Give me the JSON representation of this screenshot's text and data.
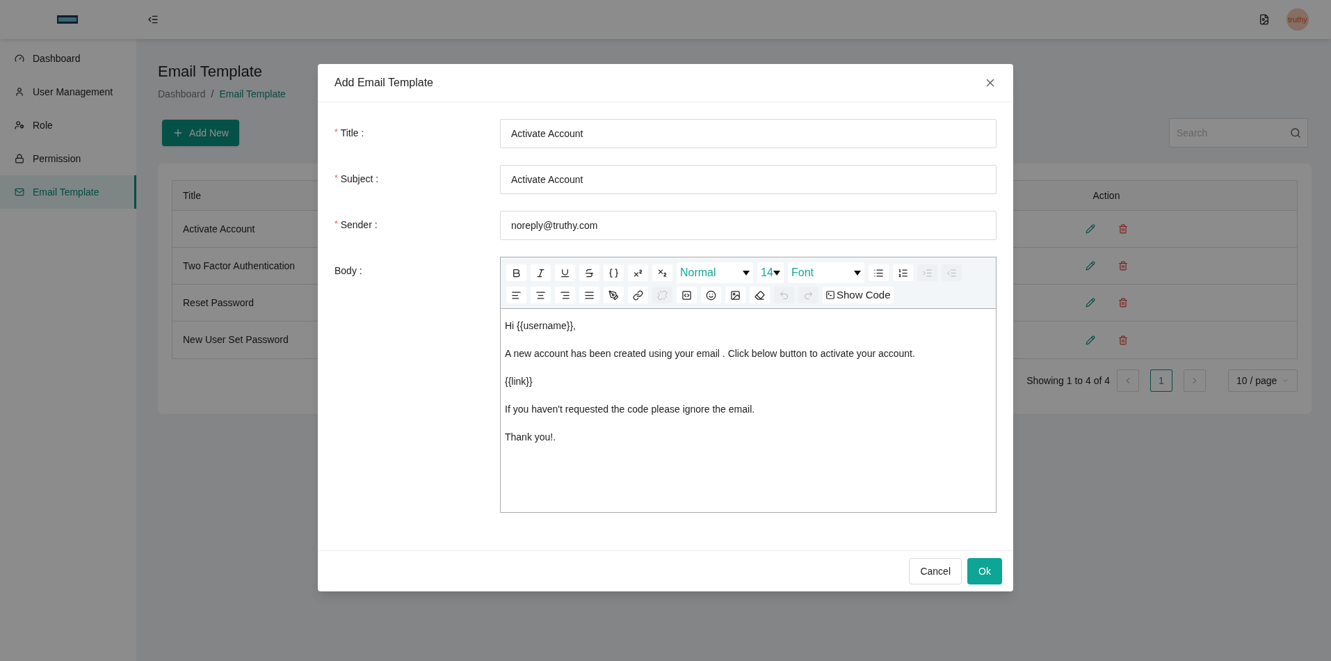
{
  "header": {
    "avatar_text": "truthy"
  },
  "sidebar": {
    "items": [
      {
        "label": "Dashboard",
        "selected": false
      },
      {
        "label": "User Management",
        "selected": false
      },
      {
        "label": "Role",
        "selected": false
      },
      {
        "label": "Permission",
        "selected": false
      },
      {
        "label": "Email Template",
        "selected": true
      }
    ]
  },
  "page": {
    "title": "Email Template",
    "breadcrumb": [
      {
        "label": "Dashboard",
        "current": false
      },
      {
        "label": "Email Template",
        "current": true
      }
    ],
    "separator": "/",
    "add_button": "Add New",
    "search": {
      "placeholder": "Search"
    }
  },
  "table": {
    "columns": [
      "Title",
      "Action"
    ],
    "rows": [
      {
        "title": "Activate Account"
      },
      {
        "title": "Two Factor Authentication"
      },
      {
        "title": "Reset Password"
      },
      {
        "title": "New User Set Password"
      }
    ]
  },
  "pagination": {
    "summary": "Showing 1 to 4 of 4",
    "pages": [
      {
        "label": "1",
        "selected": true
      }
    ],
    "page_size": "10 / page"
  },
  "modal": {
    "title": "Add Email Template",
    "required_mark": "*",
    "fields": [
      {
        "label": "Title :",
        "required": true,
        "value": "Activate Account"
      },
      {
        "label": "Subject :",
        "required": true,
        "value": "Activate Account"
      },
      {
        "label": "Sender :",
        "required": true,
        "value": "noreply@truthy.com"
      }
    ],
    "body_label": "Body :",
    "toolbar": [
      [
        {
          "kind": "icon",
          "disabled": false
        },
        {
          "kind": "icon",
          "disabled": false
        },
        {
          "kind": "icon",
          "disabled": false
        },
        {
          "kind": "icon",
          "disabled": false
        },
        {
          "kind": "icon",
          "disabled": false
        },
        {
          "kind": "icon",
          "disabled": false
        },
        {
          "kind": "icon",
          "disabled": false
        },
        {
          "kind": "select",
          "value": "Normal",
          "wide": true
        },
        {
          "kind": "select",
          "value": "14",
          "wide": false
        },
        {
          "kind": "select",
          "value": "Font",
          "wide": true
        },
        {
          "kind": "icon",
          "disabled": false
        },
        {
          "kind": "icon",
          "disabled": false
        },
        {
          "kind": "icon",
          "disabled": true
        },
        {
          "kind": "icon",
          "disabled": true
        }
      ],
      [
        {
          "kind": "icon",
          "disabled": false
        },
        {
          "kind": "icon",
          "disabled": false
        },
        {
          "kind": "icon",
          "disabled": false
        },
        {
          "kind": "icon",
          "disabled": false
        },
        {
          "kind": "icon",
          "disabled": false
        },
        {
          "kind": "icon",
          "disabled": false
        },
        {
          "kind": "icon",
          "disabled": true
        },
        {
          "kind": "icon",
          "disabled": false
        },
        {
          "kind": "icon",
          "disabled": false
        },
        {
          "kind": "icon",
          "disabled": false
        },
        {
          "kind": "icon",
          "disabled": false
        },
        {
          "kind": "icon",
          "disabled": true
        },
        {
          "kind": "icon",
          "disabled": true
        },
        {
          "kind": "label-button",
          "label": "Show Code"
        }
      ]
    ],
    "body": [
      "Hi {{username}},",
      "A new account has been created using your email . Click below button to activate your account.",
      "{{link}}",
      "If you haven't requested the code please ignore the email.",
      "Thank you!."
    ],
    "buttons": [
      {
        "label": "Cancel",
        "kind": "secondary"
      },
      {
        "label": "Ok",
        "kind": "primary"
      }
    ]
  }
}
